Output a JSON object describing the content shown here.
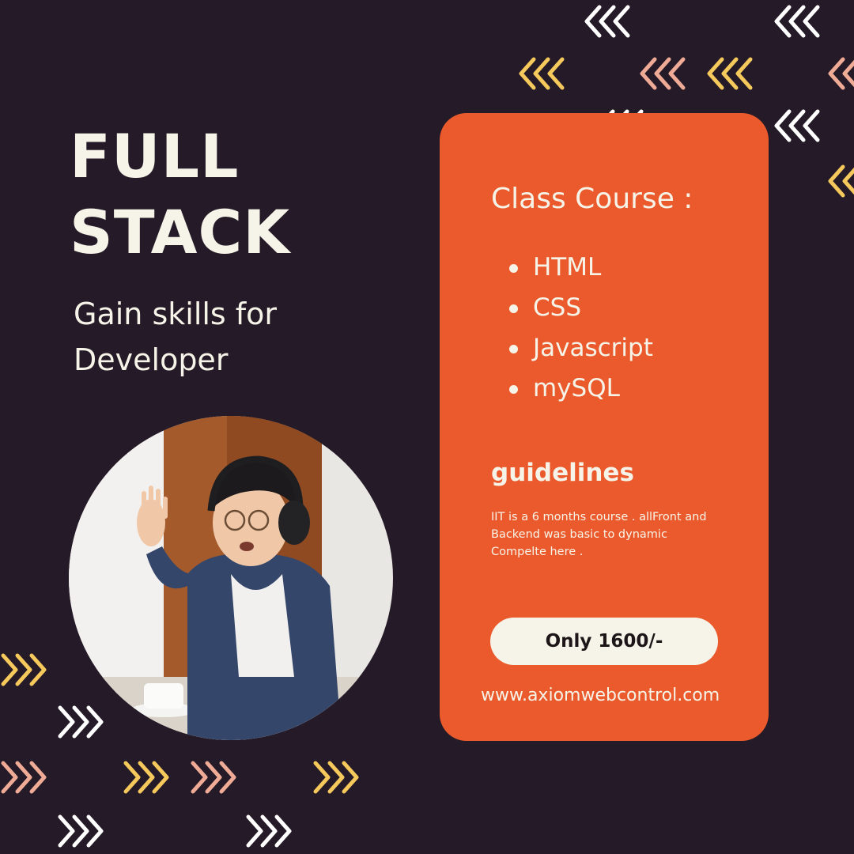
{
  "headline": {
    "line1": "FULL",
    "line2": "STACK"
  },
  "subtitle": {
    "line1": "Gain skills for",
    "line2": "Developer"
  },
  "photo": {
    "subject": "young man with headphones waving at a laptop"
  },
  "card": {
    "title": "Class Course :",
    "courses": [
      "HTML",
      "CSS",
      "Javascript",
      "mySQL"
    ],
    "guidelines_title": "guidelines",
    "guidelines_text": "IIT is a  6 months course . allFront and\nBackend was basic to dynamic\nCompelte here .",
    "price_label": "Only 1600/-",
    "website": "www.axiomwebcontrol.com"
  },
  "colors": {
    "background": "#251a27",
    "card": "#eb5a2c",
    "cream": "#f6f4e8",
    "yellow": "#f6c95c",
    "peach": "#f0ab96",
    "white": "#ffffff"
  },
  "icons": [
    "chevrons-left-icon",
    "chevrons-right-icon"
  ]
}
